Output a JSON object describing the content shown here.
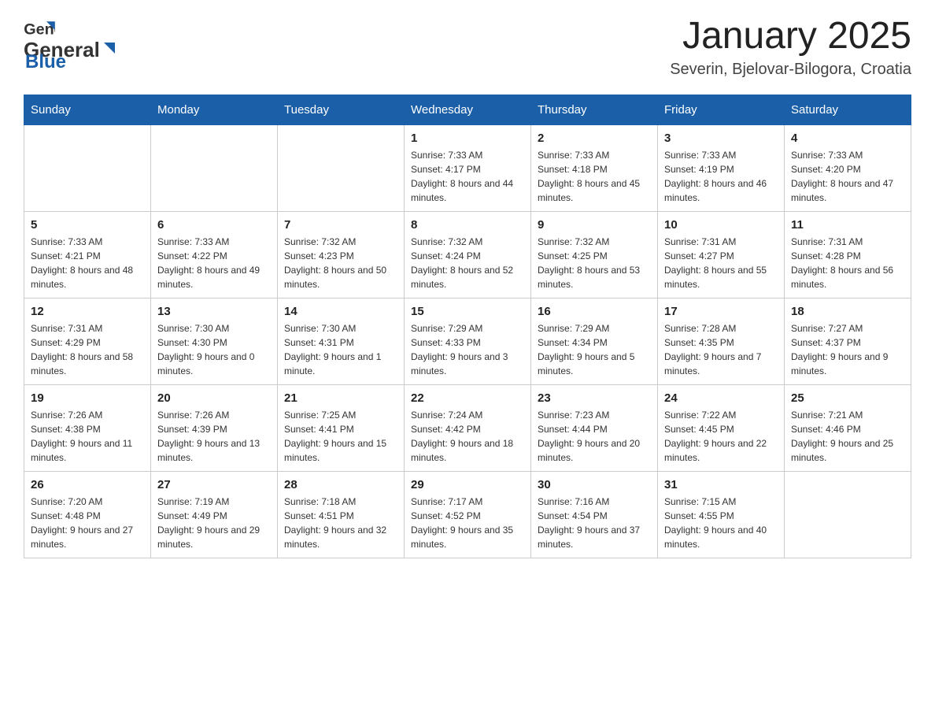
{
  "logo": {
    "general": "General",
    "blue": "Blue"
  },
  "title": {
    "month": "January 2025",
    "location": "Severin, Bjelovar-Bilogora, Croatia"
  },
  "days_of_week": [
    "Sunday",
    "Monday",
    "Tuesday",
    "Wednesday",
    "Thursday",
    "Friday",
    "Saturday"
  ],
  "weeks": [
    [
      {
        "day": "",
        "info": ""
      },
      {
        "day": "",
        "info": ""
      },
      {
        "day": "",
        "info": ""
      },
      {
        "day": "1",
        "info": "Sunrise: 7:33 AM\nSunset: 4:17 PM\nDaylight: 8 hours and 44 minutes."
      },
      {
        "day": "2",
        "info": "Sunrise: 7:33 AM\nSunset: 4:18 PM\nDaylight: 8 hours and 45 minutes."
      },
      {
        "day": "3",
        "info": "Sunrise: 7:33 AM\nSunset: 4:19 PM\nDaylight: 8 hours and 46 minutes."
      },
      {
        "day": "4",
        "info": "Sunrise: 7:33 AM\nSunset: 4:20 PM\nDaylight: 8 hours and 47 minutes."
      }
    ],
    [
      {
        "day": "5",
        "info": "Sunrise: 7:33 AM\nSunset: 4:21 PM\nDaylight: 8 hours and 48 minutes."
      },
      {
        "day": "6",
        "info": "Sunrise: 7:33 AM\nSunset: 4:22 PM\nDaylight: 8 hours and 49 minutes."
      },
      {
        "day": "7",
        "info": "Sunrise: 7:32 AM\nSunset: 4:23 PM\nDaylight: 8 hours and 50 minutes."
      },
      {
        "day": "8",
        "info": "Sunrise: 7:32 AM\nSunset: 4:24 PM\nDaylight: 8 hours and 52 minutes."
      },
      {
        "day": "9",
        "info": "Sunrise: 7:32 AM\nSunset: 4:25 PM\nDaylight: 8 hours and 53 minutes."
      },
      {
        "day": "10",
        "info": "Sunrise: 7:31 AM\nSunset: 4:27 PM\nDaylight: 8 hours and 55 minutes."
      },
      {
        "day": "11",
        "info": "Sunrise: 7:31 AM\nSunset: 4:28 PM\nDaylight: 8 hours and 56 minutes."
      }
    ],
    [
      {
        "day": "12",
        "info": "Sunrise: 7:31 AM\nSunset: 4:29 PM\nDaylight: 8 hours and 58 minutes."
      },
      {
        "day": "13",
        "info": "Sunrise: 7:30 AM\nSunset: 4:30 PM\nDaylight: 9 hours and 0 minutes."
      },
      {
        "day": "14",
        "info": "Sunrise: 7:30 AM\nSunset: 4:31 PM\nDaylight: 9 hours and 1 minute."
      },
      {
        "day": "15",
        "info": "Sunrise: 7:29 AM\nSunset: 4:33 PM\nDaylight: 9 hours and 3 minutes."
      },
      {
        "day": "16",
        "info": "Sunrise: 7:29 AM\nSunset: 4:34 PM\nDaylight: 9 hours and 5 minutes."
      },
      {
        "day": "17",
        "info": "Sunrise: 7:28 AM\nSunset: 4:35 PM\nDaylight: 9 hours and 7 minutes."
      },
      {
        "day": "18",
        "info": "Sunrise: 7:27 AM\nSunset: 4:37 PM\nDaylight: 9 hours and 9 minutes."
      }
    ],
    [
      {
        "day": "19",
        "info": "Sunrise: 7:26 AM\nSunset: 4:38 PM\nDaylight: 9 hours and 11 minutes."
      },
      {
        "day": "20",
        "info": "Sunrise: 7:26 AM\nSunset: 4:39 PM\nDaylight: 9 hours and 13 minutes."
      },
      {
        "day": "21",
        "info": "Sunrise: 7:25 AM\nSunset: 4:41 PM\nDaylight: 9 hours and 15 minutes."
      },
      {
        "day": "22",
        "info": "Sunrise: 7:24 AM\nSunset: 4:42 PM\nDaylight: 9 hours and 18 minutes."
      },
      {
        "day": "23",
        "info": "Sunrise: 7:23 AM\nSunset: 4:44 PM\nDaylight: 9 hours and 20 minutes."
      },
      {
        "day": "24",
        "info": "Sunrise: 7:22 AM\nSunset: 4:45 PM\nDaylight: 9 hours and 22 minutes."
      },
      {
        "day": "25",
        "info": "Sunrise: 7:21 AM\nSunset: 4:46 PM\nDaylight: 9 hours and 25 minutes."
      }
    ],
    [
      {
        "day": "26",
        "info": "Sunrise: 7:20 AM\nSunset: 4:48 PM\nDaylight: 9 hours and 27 minutes."
      },
      {
        "day": "27",
        "info": "Sunrise: 7:19 AM\nSunset: 4:49 PM\nDaylight: 9 hours and 29 minutes."
      },
      {
        "day": "28",
        "info": "Sunrise: 7:18 AM\nSunset: 4:51 PM\nDaylight: 9 hours and 32 minutes."
      },
      {
        "day": "29",
        "info": "Sunrise: 7:17 AM\nSunset: 4:52 PM\nDaylight: 9 hours and 35 minutes."
      },
      {
        "day": "30",
        "info": "Sunrise: 7:16 AM\nSunset: 4:54 PM\nDaylight: 9 hours and 37 minutes."
      },
      {
        "day": "31",
        "info": "Sunrise: 7:15 AM\nSunset: 4:55 PM\nDaylight: 9 hours and 40 minutes."
      },
      {
        "day": "",
        "info": ""
      }
    ]
  ]
}
